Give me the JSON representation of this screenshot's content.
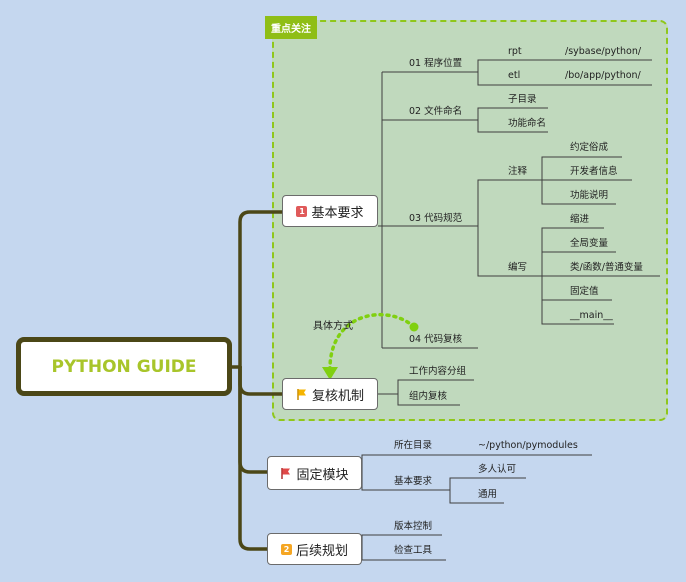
{
  "root": {
    "title": "PYTHON GUIDE"
  },
  "focus_zone": {
    "label": "重点关注"
  },
  "relation": {
    "label": "具体方式"
  },
  "main_nodes": [
    {
      "badge": "1",
      "label": "基本要求",
      "icon": "priority-1-badge",
      "color": "#e05a5a"
    },
    {
      "badge": "",
      "label": "复核机制",
      "icon": "yellow-flag-icon",
      "color": "#f5b400"
    },
    {
      "badge": "",
      "label": "固定模块",
      "icon": "red-flag-icon",
      "color": "#e04848"
    },
    {
      "badge": "2",
      "label": "后续规划",
      "icon": "priority-2-badge",
      "color": "#f5a623"
    }
  ],
  "labels": {
    "n01": "01 程序位置",
    "rpt": "rpt",
    "rpt_path": "/sybase/python/",
    "etl": "etl",
    "etl_path": "/bo/app/python/",
    "n02": "02 文件命名",
    "zimulu": "子目录",
    "gongneng_mm": "功能命名",
    "n03": "03 代码规范",
    "zhushi": "注释",
    "yueding": "约定俗成",
    "kaifazhe": "开发者信息",
    "gongneng_sm": "功能说明",
    "bianxie": "编写",
    "suojin": "缩进",
    "quanju": "全局变量",
    "leihanshu": "类/函数/普通变量",
    "gudingzhi": "固定值",
    "main": "__main__",
    "n04": "04 代码复核",
    "gongzuo": "工作内容分组",
    "zunei": "组内复核",
    "suozai": "所在目录",
    "pymod": "~/python/pymodules",
    "jiben2": "基本要求",
    "duoren": "多人认可",
    "tongyong": "通用",
    "banben": "版本控制",
    "jiancha": "检查工具"
  }
}
